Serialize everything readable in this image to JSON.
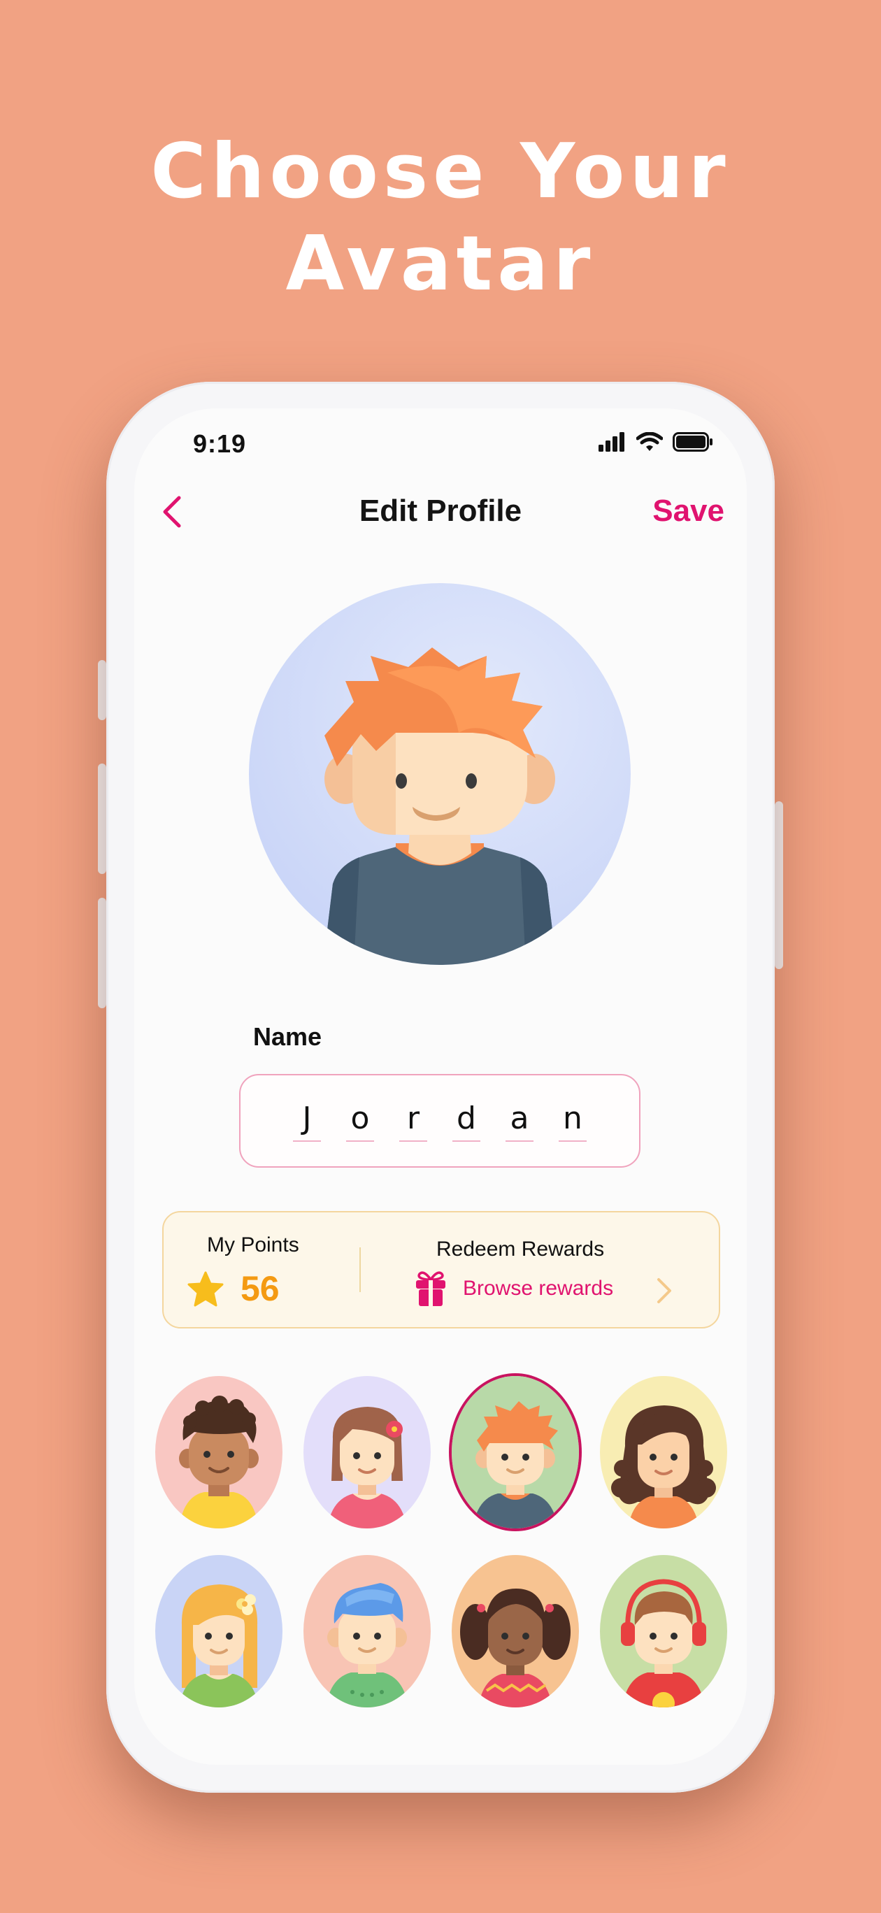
{
  "headline": {
    "line1": "Choose Your",
    "line2": "Avatar"
  },
  "status_bar": {
    "time": "9:19"
  },
  "nav": {
    "title": "Edit Profile",
    "save_label": "Save",
    "back_icon": "chevron-left-icon"
  },
  "profile": {
    "avatar_icon": "boy-orange-hair-avatar",
    "name_label": "Name",
    "name_chars": [
      "J",
      "o",
      "r",
      "d",
      "a",
      "n"
    ]
  },
  "points_card": {
    "points_label": "My Points",
    "points_value": "56",
    "redeem_label": "Redeem Rewards",
    "browse_label": "Browse rewards"
  },
  "avatars": [
    {
      "name": "curly-hair-boy-avatar",
      "bg": "#f9c7c2",
      "selected": false
    },
    {
      "name": "flower-girl-avatar",
      "bg": "#e3defa",
      "selected": false
    },
    {
      "name": "orange-hair-boy-avatar",
      "bg": "#b8d9a8",
      "selected": true
    },
    {
      "name": "long-hair-girl-avatar",
      "bg": "#f8edb3",
      "selected": false
    },
    {
      "name": "blonde-girl-avatar",
      "bg": "#c9d4f6",
      "selected": false
    },
    {
      "name": "blue-hair-boy-avatar",
      "bg": "#f8c4b4",
      "selected": false
    },
    {
      "name": "pigtails-girl-avatar",
      "bg": "#f7c391",
      "selected": false
    },
    {
      "name": "headphones-boy-avatar",
      "bg": "#c7dea5",
      "selected": false
    }
  ],
  "colors": {
    "background": "#f1a283",
    "accent": "#e0136f",
    "points": "#f49a12"
  }
}
